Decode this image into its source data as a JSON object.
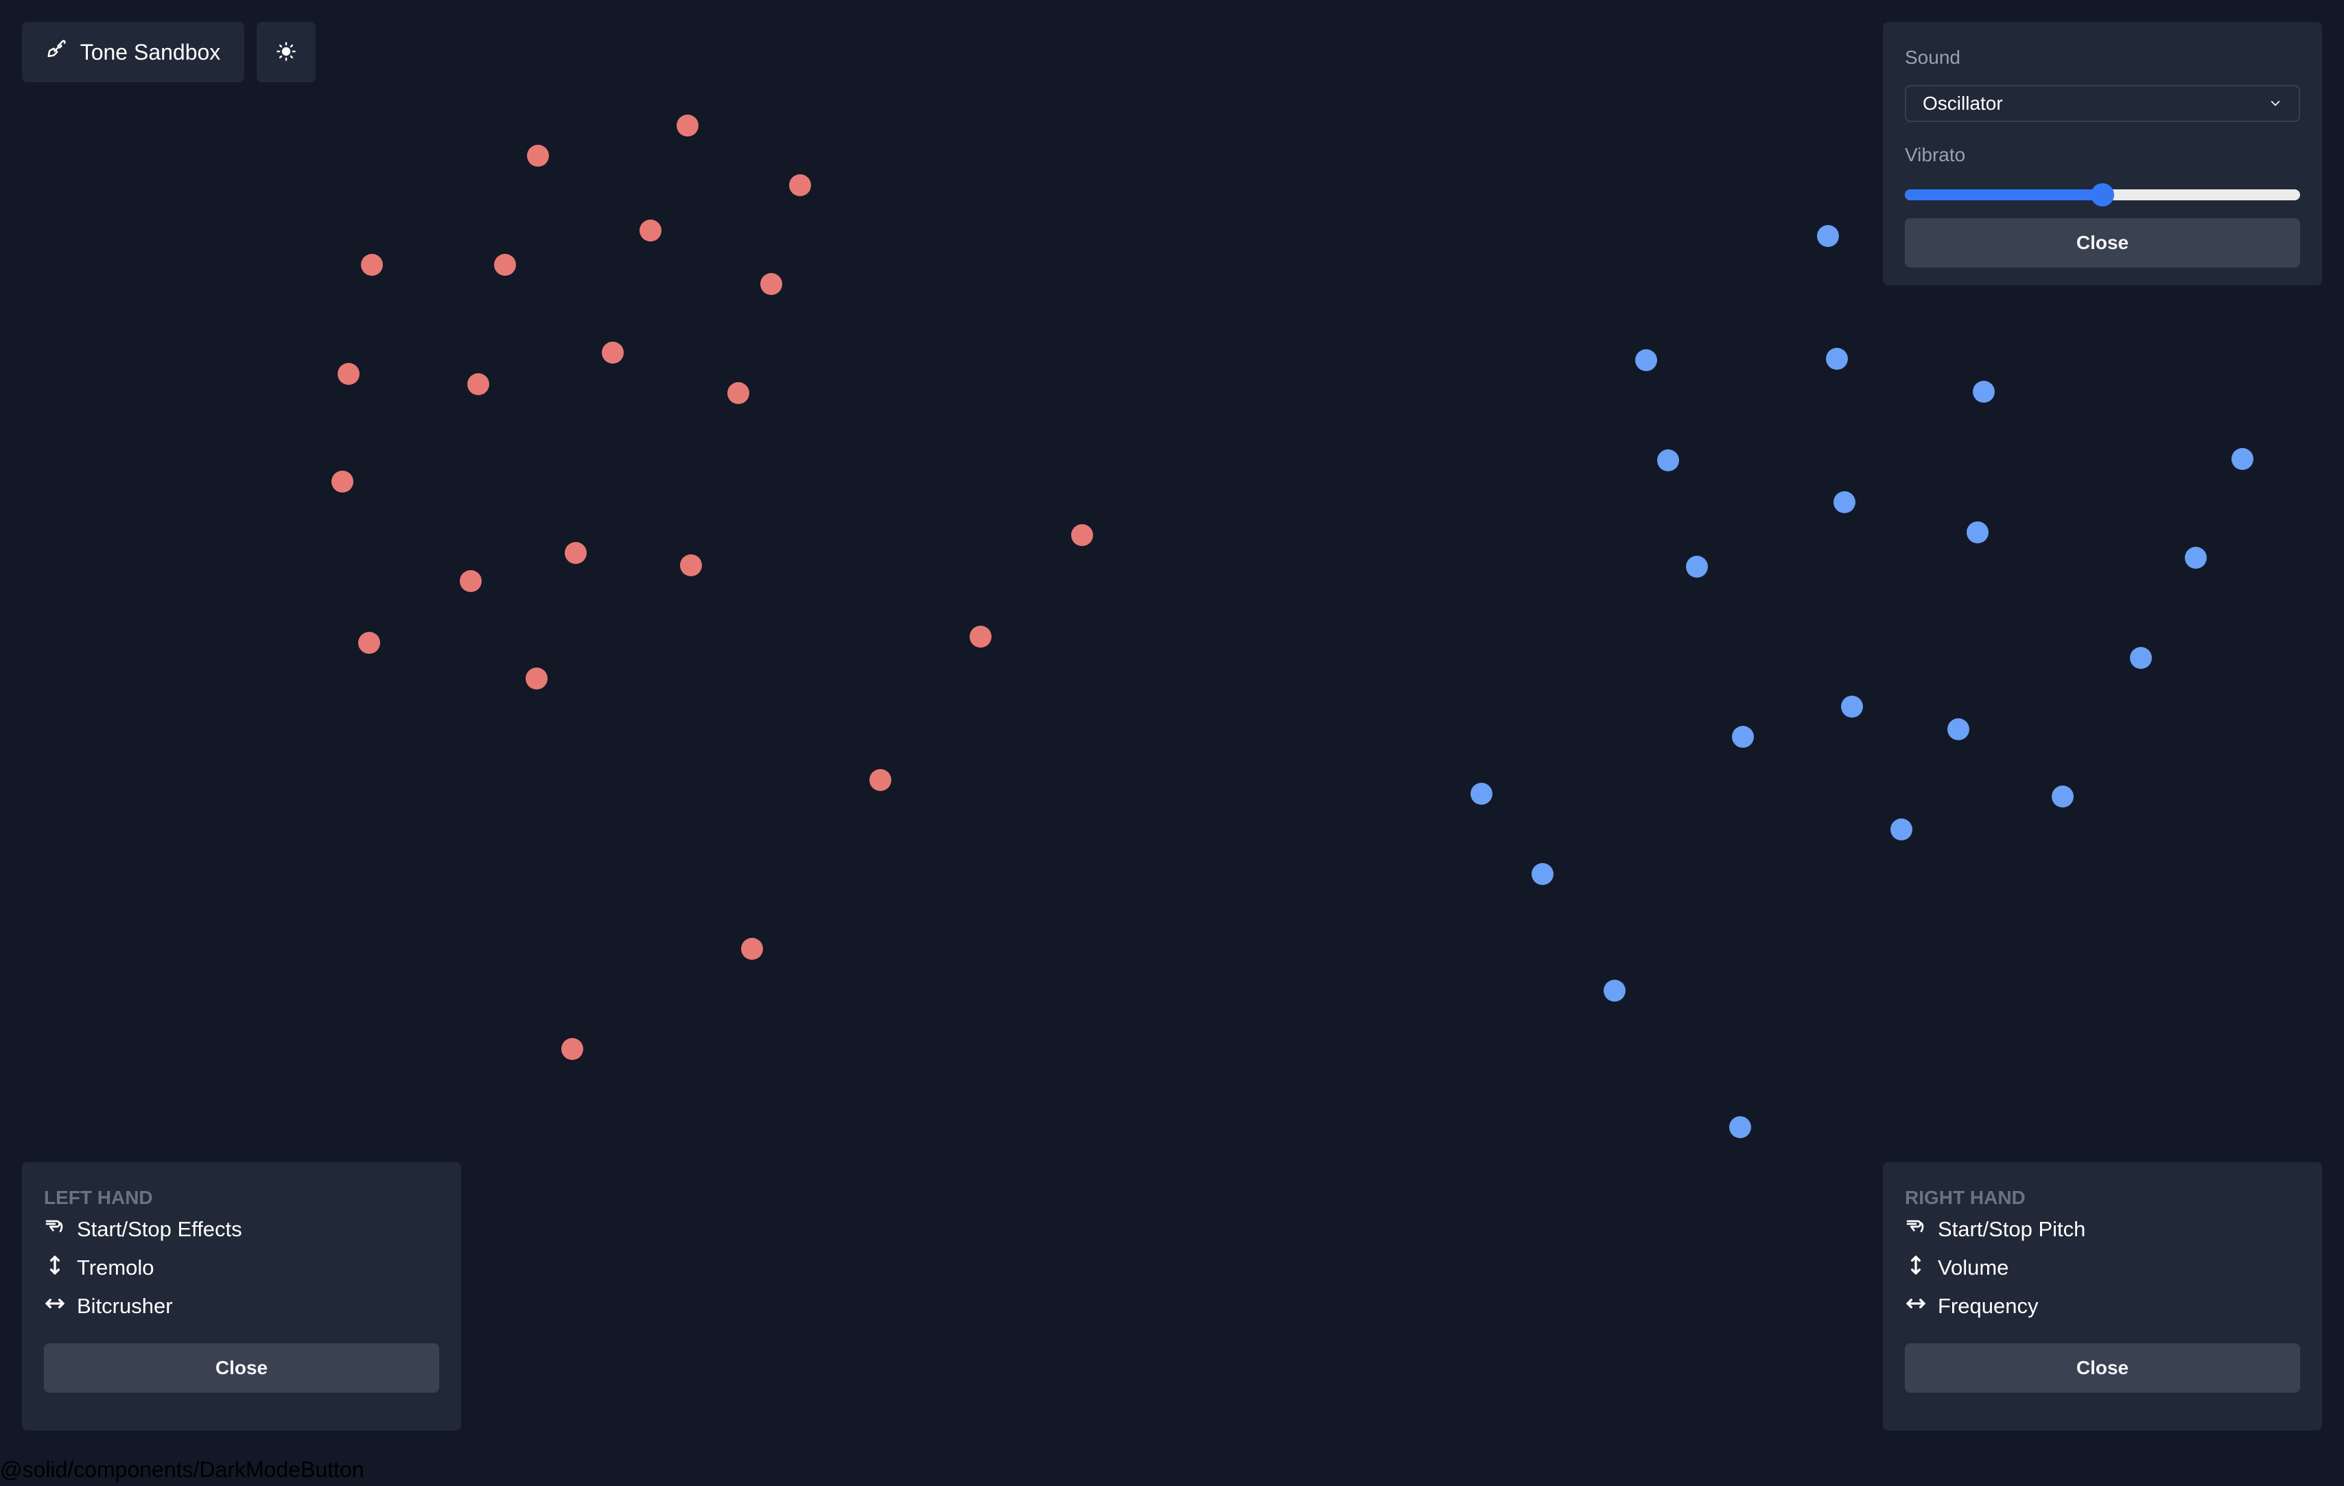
{
  "header": {
    "title_label": "Tone Sandbox",
    "title_icon": "shovel-icon",
    "theme_toggle_icon": "sun-icon"
  },
  "settings": {
    "sound_label": "Sound",
    "sound_selected": "Oscillator",
    "vibrato_label": "Vibrato",
    "vibrato_value_fraction": 0.5,
    "close_label": "Close"
  },
  "left_hand": {
    "title": "LEFT HAND",
    "gestures": [
      {
        "icon": "pinch-gesture-icon",
        "label": "Start/Stop Effects"
      },
      {
        "icon": "vertical-arrows-icon",
        "label": "Tremolo"
      },
      {
        "icon": "horizontal-arrows-icon",
        "label": "Bitcrusher"
      }
    ],
    "close_label": "Close"
  },
  "right_hand": {
    "title": "RIGHT HAND",
    "gestures": [
      {
        "icon": "pinch-gesture-icon",
        "label": "Start/Stop Pitch"
      },
      {
        "icon": "vertical-arrows-icon",
        "label": "Volume"
      },
      {
        "icon": "horizontal-arrows-icon",
        "label": "Frequency"
      }
    ],
    "close_label": "Close"
  },
  "landmarks": {
    "left_hand_color": "#e87a76",
    "right_hand_color": "#6ba1f6",
    "left_hand_count": 22,
    "right_hand_count": 20
  },
  "footer": {
    "text": "@solid/components/DarkModeButton"
  },
  "colors": {
    "background": "#121826",
    "panel": "#212837",
    "button": "#3a4150",
    "accent": "#3478f6"
  }
}
